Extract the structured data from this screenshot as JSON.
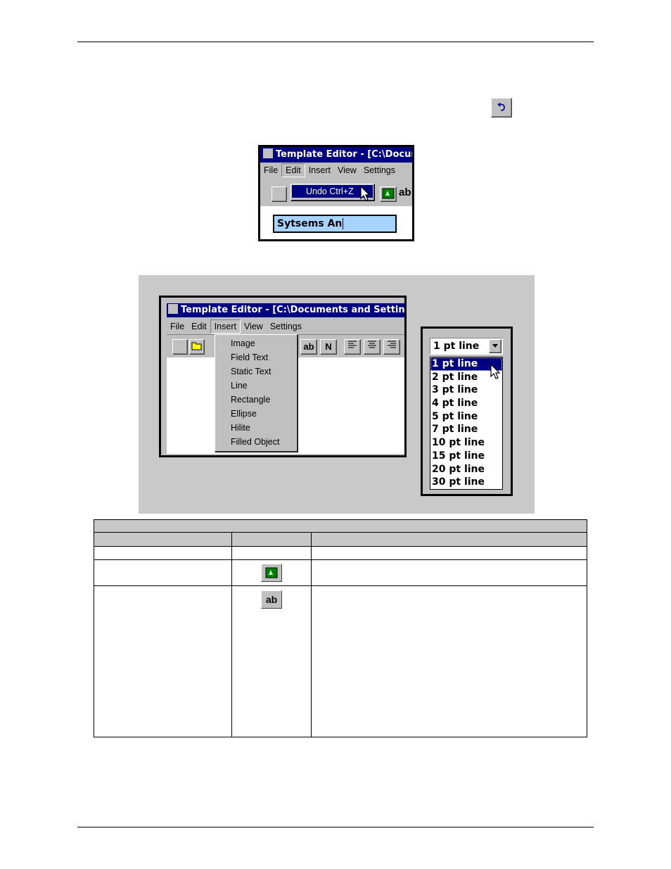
{
  "undo_toolbar": {
    "icon": "undo-icon"
  },
  "screenshot_edit_menu": {
    "title": "Template Editor - [C:\\Docum",
    "menu": [
      "File",
      "Edit",
      "Insert",
      "View",
      "Settings"
    ],
    "dropdown_item": "Undo  Ctrl+Z",
    "toolbar_partial_label": "ab",
    "text_field_value": "Sytsems An"
  },
  "screenshot_insert_menu": {
    "title": "Template Editor - [C:\\Documents and Settings\\",
    "menu": [
      "File",
      "Edit",
      "Insert",
      "View",
      "Settings"
    ],
    "insert_items": [
      "Image",
      "Field Text",
      "Static Text",
      "Line",
      "Rectangle",
      "Ellipse",
      "Hilite",
      "Filled Object"
    ],
    "toolbar_labels": {
      "ab": "ab",
      "n": "N"
    }
  },
  "screenshot_line_combo": {
    "selected": "1 pt line",
    "options": [
      "1 pt line",
      "2 pt line",
      "3 pt line",
      "4 pt line",
      "5 pt line",
      "7 pt line",
      "10 pt line",
      "15 pt line",
      "20 pt line",
      "30 pt line"
    ]
  },
  "table": {
    "icons": {
      "image_button": "image-insert-icon",
      "text_button": "ab"
    }
  }
}
